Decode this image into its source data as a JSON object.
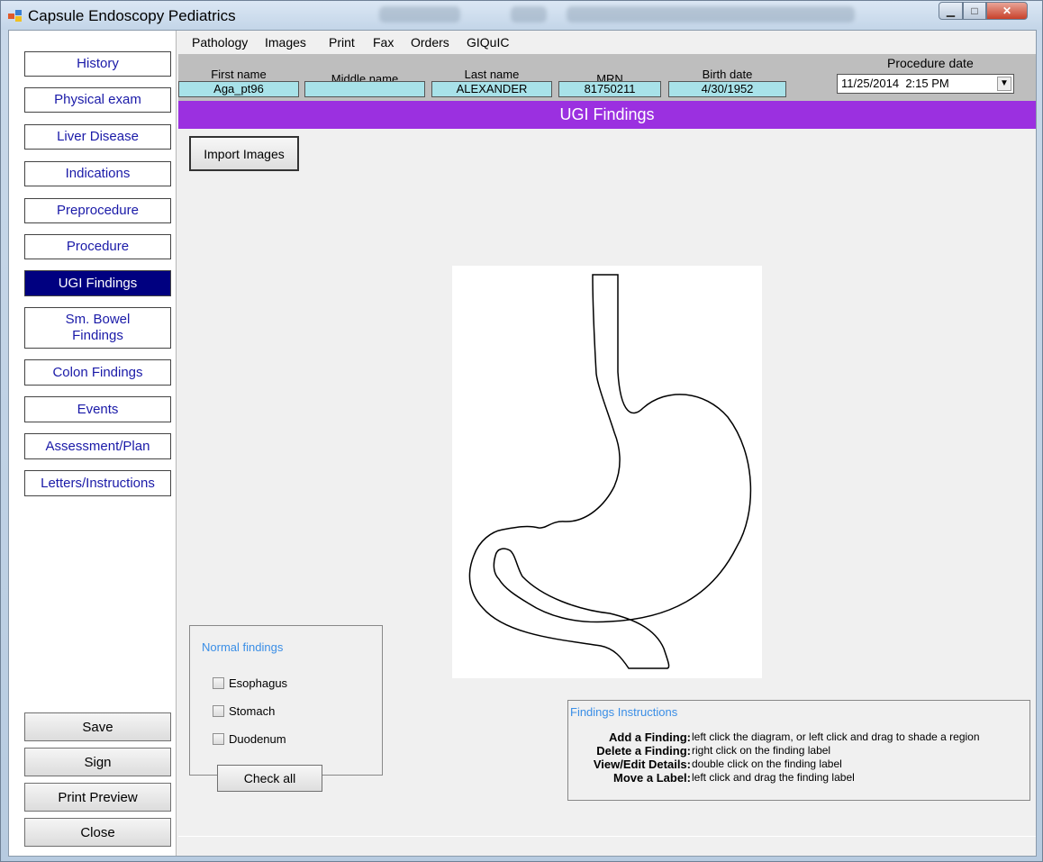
{
  "window": {
    "title": "Capsule Endoscopy Pediatrics",
    "controls": {
      "minimize": "▁",
      "maximize": "□",
      "close": "✕"
    }
  },
  "nav": {
    "items": [
      {
        "label": "History"
      },
      {
        "label": "Physical exam"
      },
      {
        "label": "Liver Disease"
      },
      {
        "label": "Indications"
      },
      {
        "label": "Preprocedure"
      },
      {
        "label": "Procedure"
      },
      {
        "label": "UGI Findings",
        "active": true
      },
      {
        "label": "Sm. Bowel Findings"
      },
      {
        "label": "Colon Findings"
      },
      {
        "label": "Events"
      },
      {
        "label": "Assessment/Plan"
      },
      {
        "label": "Letters/Instructions"
      }
    ],
    "actions": {
      "save": "Save",
      "sign": "Sign",
      "print_preview": "Print Preview",
      "close": "Close"
    }
  },
  "menu": {
    "items": [
      "Pathology",
      "Images",
      "Print",
      "Fax",
      "Orders",
      "GIQuIC"
    ]
  },
  "patient": {
    "first_name_label": "First name",
    "first_name": "Aga_pt96",
    "middle_name_label": "Middle name",
    "middle_name": "",
    "last_name_label": "Last name",
    "last_name": "ALEXANDER",
    "mrn_label": "MRN",
    "mrn": "81750211",
    "birth_date_label": "Birth date",
    "birth_date": "4/30/1952",
    "procedure_date_label": "Procedure date",
    "procedure_date": "11/25/2014  2:15 PM"
  },
  "section": {
    "title": "UGI Findings"
  },
  "import_button": "Import Images",
  "normal_findings": {
    "title": "Normal findings",
    "items": [
      "Esophagus",
      "Stomach",
      "Duodenum"
    ],
    "check_all": "Check all"
  },
  "instructions": {
    "title": "Findings Instructions",
    "rows": [
      {
        "key": "Add a Finding:",
        "text": "left click the diagram, or left click and drag to shade a region"
      },
      {
        "key": "Delete a Finding:",
        "text": "right click on the finding label"
      },
      {
        "key": "View/Edit Details:",
        "text": "double click on the finding label"
      },
      {
        "key": "Move a Label:",
        "text": "left click and drag the finding label"
      }
    ]
  },
  "colors": {
    "header_purple": "#9b30e0",
    "active_nav": "#000080",
    "field_cyan": "#a8e2e9",
    "nav_text": "#1a1aa8"
  }
}
